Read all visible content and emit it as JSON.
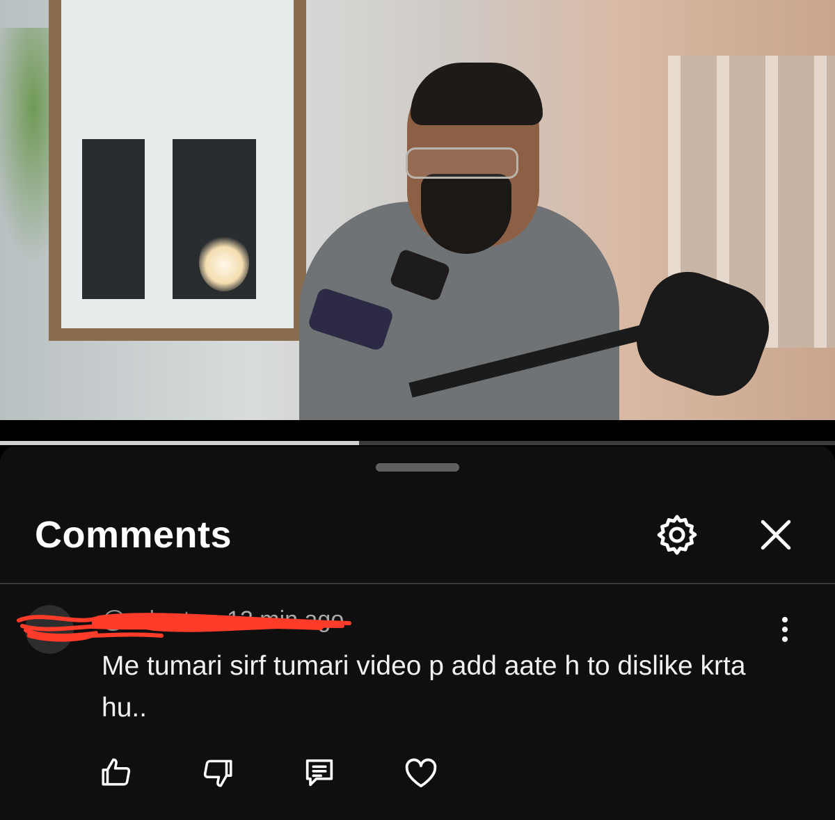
{
  "video": {
    "progress_fraction": 0.43
  },
  "comments_sheet": {
    "title": "Comments",
    "settings_icon": "gear-icon",
    "close_icon": "close-icon"
  },
  "comment": {
    "author": "@…horts",
    "separator": "•",
    "time": "12 min ago",
    "text": "Me tumari sirf tumari video p add aate h to dislike krta hu..",
    "more_icon": "more-vertical-icon",
    "actions": [
      "thumbs-up-icon",
      "thumbs-down-icon",
      "reply-icon",
      "heart-icon"
    ]
  },
  "colors": {
    "sheet_bg": "#0f0f0f",
    "redaction": "#ff3b2a"
  }
}
